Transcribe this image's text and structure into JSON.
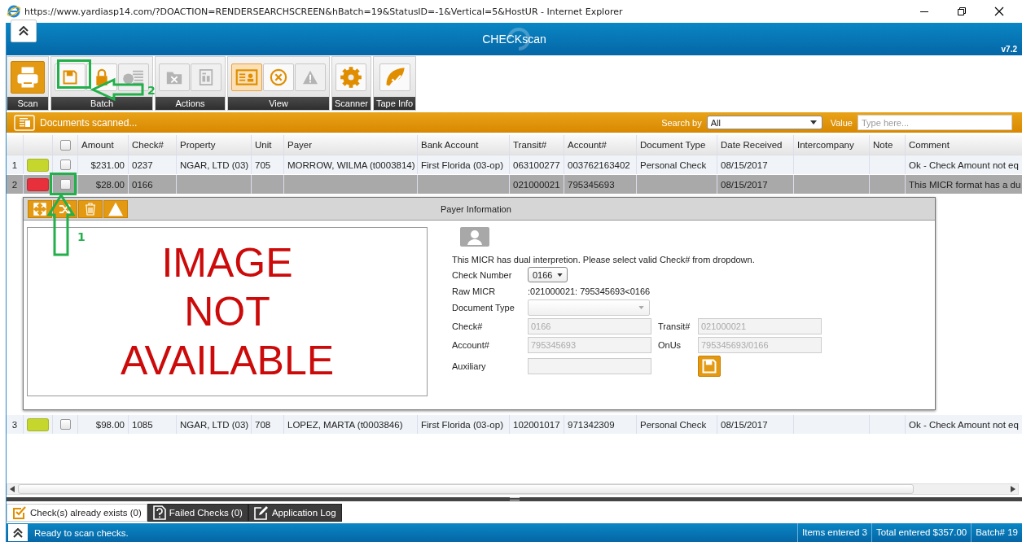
{
  "window": {
    "title": "https://www.yardiasp14.com/?DOACTION=RENDERSEARCHSCREEN&hBatch=19&StatusID=-1&Vertical=5&HostUR - Internet Explorer"
  },
  "app": {
    "title": "CHECKscan",
    "version": "v7.2"
  },
  "toolbar": [
    {
      "label": "Scan",
      "buttons": [
        {
          "kind": "printer",
          "selected": true,
          "disabled": false
        }
      ]
    },
    {
      "label": "Batch",
      "buttons": [
        {
          "kind": "save",
          "selected": false,
          "disabled": false
        },
        {
          "kind": "lock",
          "selected": false,
          "disabled": false
        },
        {
          "kind": "money-list",
          "selected": false,
          "disabled": true
        }
      ]
    },
    {
      "label": "Actions",
      "buttons": [
        {
          "kind": "folder-x",
          "selected": false,
          "disabled": true
        },
        {
          "kind": "document",
          "selected": false,
          "disabled": true
        }
      ]
    },
    {
      "label": "View",
      "buttons": [
        {
          "kind": "id-card",
          "selected": true,
          "disabled": false
        },
        {
          "kind": "x-circle",
          "selected": false,
          "disabled": false
        },
        {
          "kind": "warning",
          "selected": false,
          "disabled": true
        }
      ]
    },
    {
      "label": "Scanner",
      "buttons": [
        {
          "kind": "gear",
          "selected": false,
          "disabled": false
        }
      ]
    },
    {
      "label": "Tape Info",
      "buttons": [
        {
          "kind": "leaf",
          "selected": false,
          "disabled": false
        }
      ]
    }
  ],
  "annotations": [
    {
      "kind": "left-arrow",
      "label": "2"
    },
    {
      "kind": "up-arrow",
      "label": "1"
    }
  ],
  "documents_bar": {
    "title": "Documents scanned...",
    "search_by_label": "Search by",
    "search_by": "All",
    "value_label": "Value",
    "value_placeholder": "Type here..."
  },
  "table": {
    "header_checked": false,
    "columns": [
      "Amount",
      "Check#",
      "Property",
      "Unit",
      "Payer",
      "Bank Account",
      "Transit#",
      "Account#",
      "Document Type",
      "Date Received",
      "Intercompany",
      "Note",
      "Comment"
    ],
    "rows": [
      {
        "number": "1",
        "color": "#c5d62c",
        "checked": false,
        "selected": false,
        "cells": [
          "$231.00",
          "0237",
          "NGAR, LTD (03)",
          "705",
          "MORROW, WILMA (t0003814)",
          "First Florida (03-op)",
          "063100277",
          "003762163402",
          "Personal Check",
          "08/15/2017",
          null,
          null,
          "Ok - Check Amount not eq"
        ]
      },
      {
        "number": "2",
        "color": "#e8303c",
        "checked": false,
        "selected": true,
        "cells": [
          "$28.00",
          "0166",
          null,
          null,
          null,
          null,
          "021000021",
          "795345693",
          null,
          "08/15/2017",
          null,
          null,
          "This MICR format has a du"
        ],
        "detail": {
          "title": "Payer Information",
          "tools": [
            {
              "kind": "expand"
            },
            {
              "kind": "shuffle"
            },
            {
              "kind": "delete"
            },
            {
              "kind": "warning"
            }
          ],
          "image_text": "IMAGE NOT AVAILABLE",
          "message": "This MICR has dual interpretion. Please select valid Check# from dropdown.",
          "check_number": {
            "label": "Check Number",
            "value": "0166"
          },
          "raw_micr": {
            "label": "Raw MICR",
            "value": ":021000021: 795345693<0166"
          },
          "document_type": {
            "label": "Document Type"
          },
          "fields": [
            {
              "label": "Check#",
              "value": "0166",
              "disabled": true
            },
            {
              "label": "Transit#",
              "value": "021000021",
              "disabled": true
            },
            {
              "label": "Account#",
              "value": "795345693",
              "disabled": true
            },
            {
              "label": "OnUs",
              "value": "795345693/0166",
              "disabled": true
            },
            {
              "label": "Auxiliary",
              "disabled": true
            }
          ]
        }
      },
      {
        "number": "3",
        "color": "#c5d62c",
        "checked": false,
        "selected": false,
        "cells": [
          "$98.00",
          "1085",
          "NGAR, LTD (03)",
          "708",
          "LOPEZ, MARTA (t0003846)",
          "First Florida (03-op)",
          "102001017",
          "971342309",
          "Personal Check",
          "08/15/2017",
          null,
          null,
          "Ok - Check Amount not eq"
        ]
      }
    ]
  },
  "bottom_tabs": [
    {
      "kind": "check",
      "label": "Check(s) already exists (0)",
      "selected": true
    },
    {
      "kind": "question",
      "label": "Failed Checks (0)",
      "selected": false
    },
    {
      "kind": "edit",
      "label": "Application Log",
      "selected": false
    }
  ],
  "status_bar": {
    "message": "Ready to scan checks.",
    "items": [
      "Items entered 3",
      "Total entered $357.00",
      "Batch# 19"
    ]
  }
}
